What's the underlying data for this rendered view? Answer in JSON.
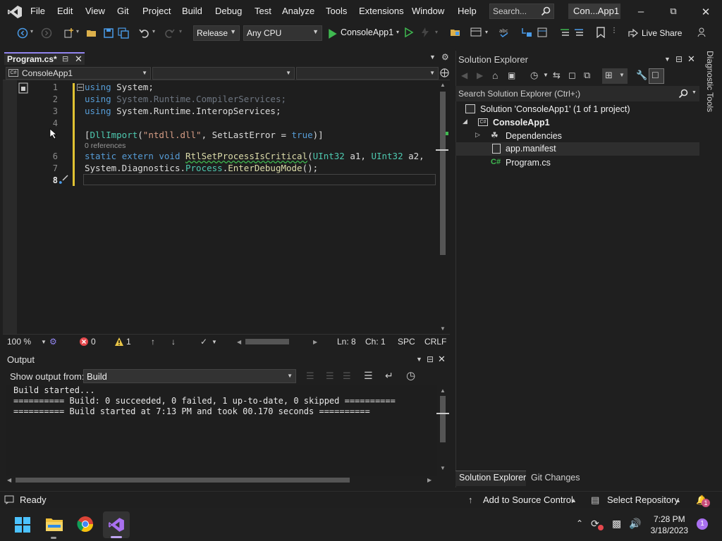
{
  "menu": {
    "items": [
      "File",
      "Edit",
      "View",
      "Git",
      "Project",
      "Build",
      "Debug",
      "Test",
      "Analyze",
      "Tools",
      "Extensions",
      "Window",
      "Help"
    ],
    "search_placeholder": "Search...",
    "window_title": "Con...App1"
  },
  "toolbar": {
    "configuration": "Release",
    "platform": "Any CPU",
    "run_target": "ConsoleApp1",
    "live_share": "Live Share"
  },
  "editor": {
    "tab_name": "Program.cs*",
    "project_combo": "ConsoleApp1",
    "line_numbers": [
      "1",
      "2",
      "3",
      "4",
      "",
      "6",
      "7",
      "8"
    ],
    "code": {
      "l1_kw": "using",
      "l1_rest": " System;",
      "l2_kw": "using",
      "l2_a": " System",
      "l2_b": ".Runtime.CompilerServices;",
      "l3_kw": "using",
      "l3_a": " System",
      "l3_b": ".Runtime.InteropServices;",
      "l5_a": "[",
      "l5_attr": "DllImport",
      "l5_b": "(",
      "l5_str": "\"ntdll.dll\"",
      "l5_c": ", SetLastError = ",
      "l5_true": "true",
      "l5_d": ")]",
      "l6_static": "static",
      "l6_extern": "extern",
      "l6_void": "void",
      "l6_method": "RtlSetProcessIsCritical",
      "l6_p1type": "UInt32",
      "l6_p1": " a1, ",
      "l6_p2type": "UInt32",
      "l6_p2": " a2, ",
      "l7_a": "System",
      "l7_b": ".Diagnostics.",
      "l7_type": "Process",
      "l7_c": ".",
      "l7_method": "EnterDebugMode",
      "l7_d": "();"
    },
    "references": "0 references",
    "status": {
      "zoom": "100 %",
      "errors": "0",
      "warnings": "1",
      "line": "Ln: 8",
      "col": "Ch: 1",
      "spc": "SPC",
      "crlf": "CRLF"
    }
  },
  "output": {
    "title": "Output",
    "show_from_label": "Show output from:",
    "source": "Build",
    "lines": [
      "Build started...",
      "========== Build: 0 succeeded, 0 failed, 1 up-to-date, 0 skipped ==========",
      "========== Build started at 7:13 PM and took 00.170 seconds =========="
    ]
  },
  "solution_explorer": {
    "title": "Solution Explorer",
    "search_placeholder": "Search Solution Explorer (Ctrl+;)",
    "tree": {
      "solution": "Solution 'ConsoleApp1' (1 of 1 project)",
      "project": "ConsoleApp1",
      "dependencies": "Dependencies",
      "manifest": "app.manifest",
      "program": "Program.cs"
    },
    "tabs": [
      "Solution Explorer",
      "Git Changes"
    ]
  },
  "diagnostic_tools": "Diagnostic Tools",
  "statusbar": {
    "ready": "Ready",
    "add_source": "Add to Source Control",
    "select_repo": "Select Repository",
    "notifications": "1"
  },
  "taskbar": {
    "time": "7:28 PM",
    "date": "3/18/2023",
    "badge": "1"
  },
  "colors": {
    "accent": "#9184ee",
    "keyword": "#569cd6",
    "type": "#4ec9b0",
    "string": "#d69d85",
    "method": "#dcdcaa",
    "change_bar": "#e0c232"
  }
}
